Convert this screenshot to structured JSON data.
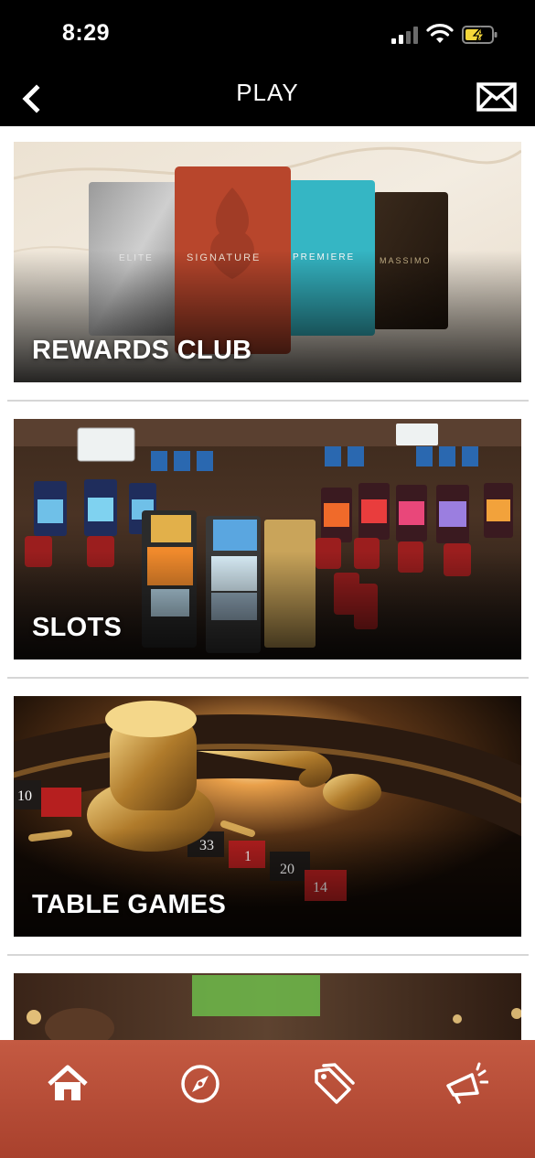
{
  "status_bar": {
    "time": "8:29"
  },
  "header": {
    "title": "PLAY"
  },
  "cards": [
    {
      "label": "REWARDS CLUB",
      "tiers": [
        "ELITE",
        "SIGNATURE",
        "PREMIERE",
        "MASSIMO"
      ]
    },
    {
      "label": "SLOTS"
    },
    {
      "label": "TABLE GAMES",
      "wheel_numbers": [
        "10",
        "33",
        "1",
        "20",
        "14"
      ]
    },
    {
      "label": ""
    }
  ],
  "bottom_nav": [
    "home-icon",
    "compass-icon",
    "tags-icon",
    "megaphone-icon"
  ],
  "colors": {
    "nav_bg": "#c45a42",
    "header_bg": "#000000"
  }
}
